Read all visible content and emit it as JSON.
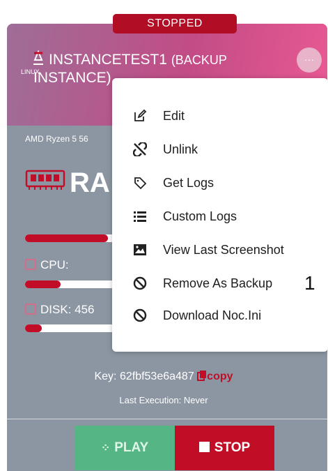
{
  "status": "STOPPED",
  "instance": {
    "name_line1": "INSTANCETEST1",
    "name_suffix": "(BACKUP",
    "name_line2": "INSTANCE)",
    "os_label": "LINUX",
    "cpu_model": "AMD Ryzen 5 56",
    "ram_label": "RA",
    "cpu_label": "CPU:",
    "disk_label": "DISK: 456",
    "more_label": "···"
  },
  "bars": {
    "ram_fraction": 0.35,
    "cpu_fraction": 0.15,
    "disk_fraction": 0.07
  },
  "menu": {
    "items": [
      {
        "label": "Edit",
        "icon": "edit-icon"
      },
      {
        "label": "Unlink",
        "icon": "unlink-icon"
      },
      {
        "label": "Get Logs",
        "icon": "tag-icon"
      },
      {
        "label": "Custom Logs",
        "icon": "list-icon"
      },
      {
        "label": "View Last Screenshot",
        "icon": "image-icon"
      },
      {
        "label": "Remove As Backup",
        "icon": "ban-icon"
      },
      {
        "label": "Download Noc.Ini",
        "icon": "ban-icon"
      }
    ],
    "marker": "1"
  },
  "key": {
    "prefix": "Key: 62fbf53e6a487",
    "copy_label": "copy"
  },
  "last_execution": "Last Execution: Never",
  "buttons": {
    "play": "PLAY",
    "stop": "STOP"
  },
  "colors": {
    "accent": "#c10d27",
    "play": "#55b584",
    "card": "#8c96a2"
  }
}
